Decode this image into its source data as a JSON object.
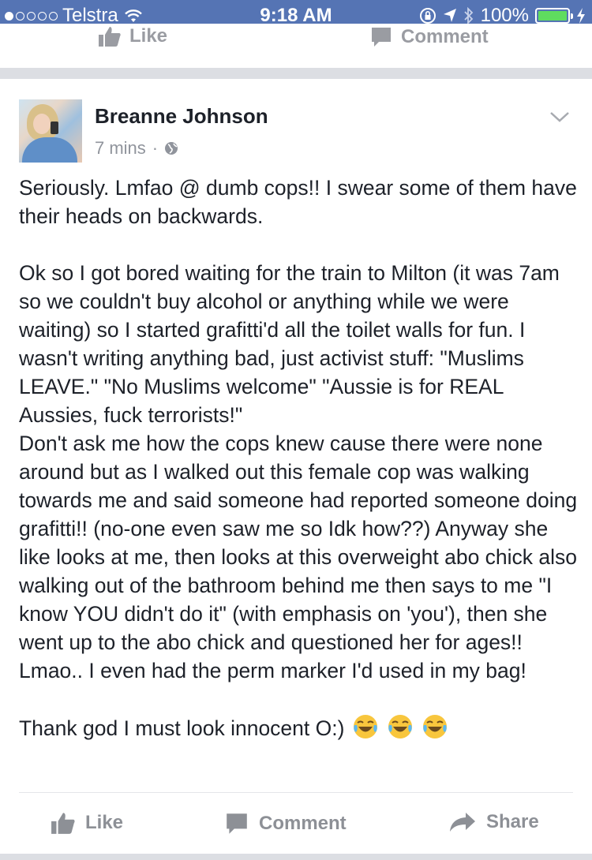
{
  "status_bar": {
    "carrier": "Telstra",
    "time": "9:18 AM",
    "battery": "100%",
    "signal_bars_filled": 1,
    "signal_bars_total": 5
  },
  "previous_post": {
    "like_label": "Like",
    "comment_label": "Comment"
  },
  "post": {
    "author": "Breanne Johnson",
    "time_ago": "7 mins",
    "separator": "·",
    "paragraphs": [
      "Seriously. Lmfao @ dumb cops!! I swear some of them have their heads on backwards.",
      "Ok so I got bored waiting for the train to Milton (it was 7am so we couldn't buy alcohol or anything while we were waiting) so I started grafitti'd all the toilet walls for fun. I wasn't writing anything bad, just activist stuff: \"Muslims LEAVE.\" \"No Muslims welcome\" \"Aussie is for REAL Aussies, fuck terrorists!\"",
      "Don't ask me how the cops knew cause there were none around but as I walked out this female cop was walking towards me and said someone had reported someone doing grafitti!! (no-one even saw me so Idk how??) Anyway she like looks at me, then looks at this overweight abo chick also walking out of the bathroom behind me then says to me \"I know YOU didn't do it\" (with emphasis on 'you'), then she went up to the abo chick and questioned her for ages!! Lmao.. I even had the perm marker I'd used in my bag!",
      "Thank god I must look innocent O:)"
    ],
    "actions": {
      "like_label": "Like",
      "comment_label": "Comment",
      "share_label": "Share"
    }
  },
  "colors": {
    "status_bar_bg": "#5574b4",
    "action_gray": "#8d9096",
    "divider": "#dcdee3"
  },
  "icons": [
    "wifi-icon",
    "lock-rotation-icon",
    "location-icon",
    "bluetooth-icon",
    "battery-icon",
    "charging-icon",
    "globe-icon",
    "chevron-down-icon",
    "thumbs-up-icon",
    "comment-icon",
    "share-icon",
    "laughing-emoji-icon"
  ]
}
